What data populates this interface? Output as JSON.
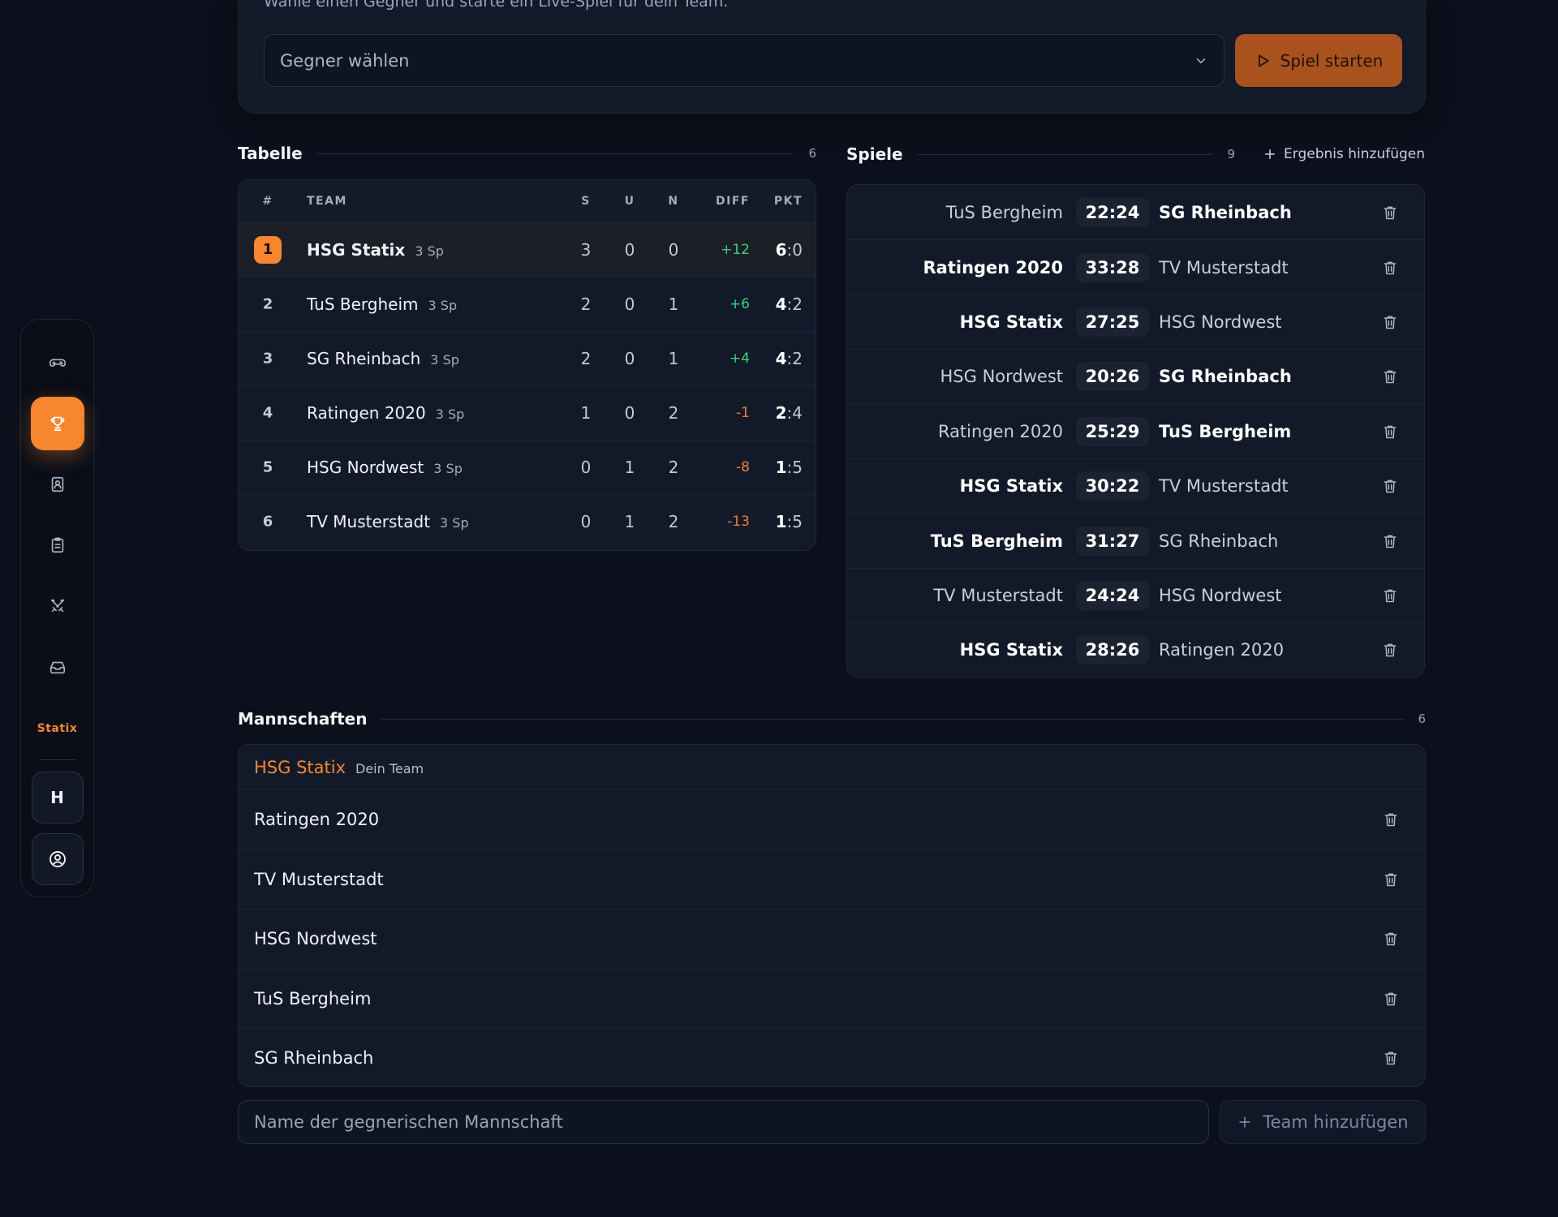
{
  "top": {
    "hint": "Wähle einen Gegner und starte ein Live-Spiel für dein Team.",
    "select_placeholder": "Gegner wählen",
    "start_label": "Spiel starten"
  },
  "sidebar": {
    "logo_text": "Statix",
    "team_initial": "H",
    "items": [
      {
        "icon": "gamepad-icon"
      },
      {
        "icon": "trophy-icon",
        "active": true
      },
      {
        "icon": "contact-book-icon"
      },
      {
        "icon": "clipboard-icon"
      },
      {
        "icon": "crossed-swords-icon"
      },
      {
        "icon": "inbox-icon"
      }
    ]
  },
  "table": {
    "title": "Tabelle",
    "count": "6",
    "headers": {
      "rank": "#",
      "team": "TEAM",
      "s": "S",
      "u": "U",
      "n": "N",
      "diff": "DIFF",
      "pkt": "PKT"
    },
    "rows": [
      {
        "rank": "1",
        "team": "HSG Statix",
        "games": "3 Sp",
        "s": "3",
        "u": "0",
        "n": "0",
        "diff": "+12",
        "pkt_a": "6",
        "pkt_b": ":0"
      },
      {
        "rank": "2",
        "team": "TuS Bergheim",
        "games": "3 Sp",
        "s": "2",
        "u": "0",
        "n": "1",
        "diff": "+6",
        "pkt_a": "4",
        "pkt_b": ":2"
      },
      {
        "rank": "3",
        "team": "SG Rheinbach",
        "games": "3 Sp",
        "s": "2",
        "u": "0",
        "n": "1",
        "diff": "+4",
        "pkt_a": "4",
        "pkt_b": ":2"
      },
      {
        "rank": "4",
        "team": "Ratingen 2020",
        "games": "3 Sp",
        "s": "1",
        "u": "0",
        "n": "2",
        "diff": "-1",
        "pkt_a": "2",
        "pkt_b": ":4"
      },
      {
        "rank": "5",
        "team": "HSG Nordwest",
        "games": "3 Sp",
        "s": "0",
        "u": "1",
        "n": "2",
        "diff": "-8",
        "pkt_a": "1",
        "pkt_b": ":5"
      },
      {
        "rank": "6",
        "team": "TV Musterstadt",
        "games": "3 Sp",
        "s": "0",
        "u": "1",
        "n": "2",
        "diff": "-13",
        "pkt_a": "1",
        "pkt_b": ":5"
      }
    ]
  },
  "games": {
    "title": "Spiele",
    "count": "9",
    "add_label": "Ergebnis hinzufügen",
    "rows": [
      {
        "home": "TuS Bergheim",
        "score": "22:24",
        "away": "SG Rheinbach",
        "winner": "away"
      },
      {
        "home": "Ratingen 2020",
        "score": "33:28",
        "away": "TV Musterstadt",
        "winner": "home"
      },
      {
        "home": "HSG Statix",
        "score": "27:25",
        "away": "HSG Nordwest",
        "winner": "home"
      },
      {
        "home": "HSG Nordwest",
        "score": "20:26",
        "away": "SG Rheinbach",
        "winner": "away"
      },
      {
        "home": "Ratingen 2020",
        "score": "25:29",
        "away": "TuS Bergheim",
        "winner": "away"
      },
      {
        "home": "HSG Statix",
        "score": "30:22",
        "away": "TV Musterstadt",
        "winner": "home"
      },
      {
        "home": "TuS Bergheim",
        "score": "31:27",
        "away": "SG Rheinbach",
        "winner": "home"
      },
      {
        "home": "TV Musterstadt",
        "score": "24:24",
        "away": "HSG Nordwest",
        "winner": "none"
      },
      {
        "home": "HSG Statix",
        "score": "28:26",
        "away": "Ratingen 2020",
        "winner": "home"
      }
    ]
  },
  "teams": {
    "title": "Mannschaften",
    "count": "6",
    "own": {
      "name": "HSG Statix",
      "tag": "Dein Team"
    },
    "others": [
      "Ratingen 2020",
      "TV Musterstadt",
      "HSG Nordwest",
      "TuS Bergheim",
      "SG Rheinbach"
    ],
    "input_placeholder": "Name der gegnerischen Mannschaft",
    "add_label": "Team hinzufügen"
  },
  "colors": {
    "accent": "#f7862f",
    "background": "#0b101c",
    "card": "#121a2a",
    "positive": "#3dd178",
    "negative": "#f77b35"
  }
}
